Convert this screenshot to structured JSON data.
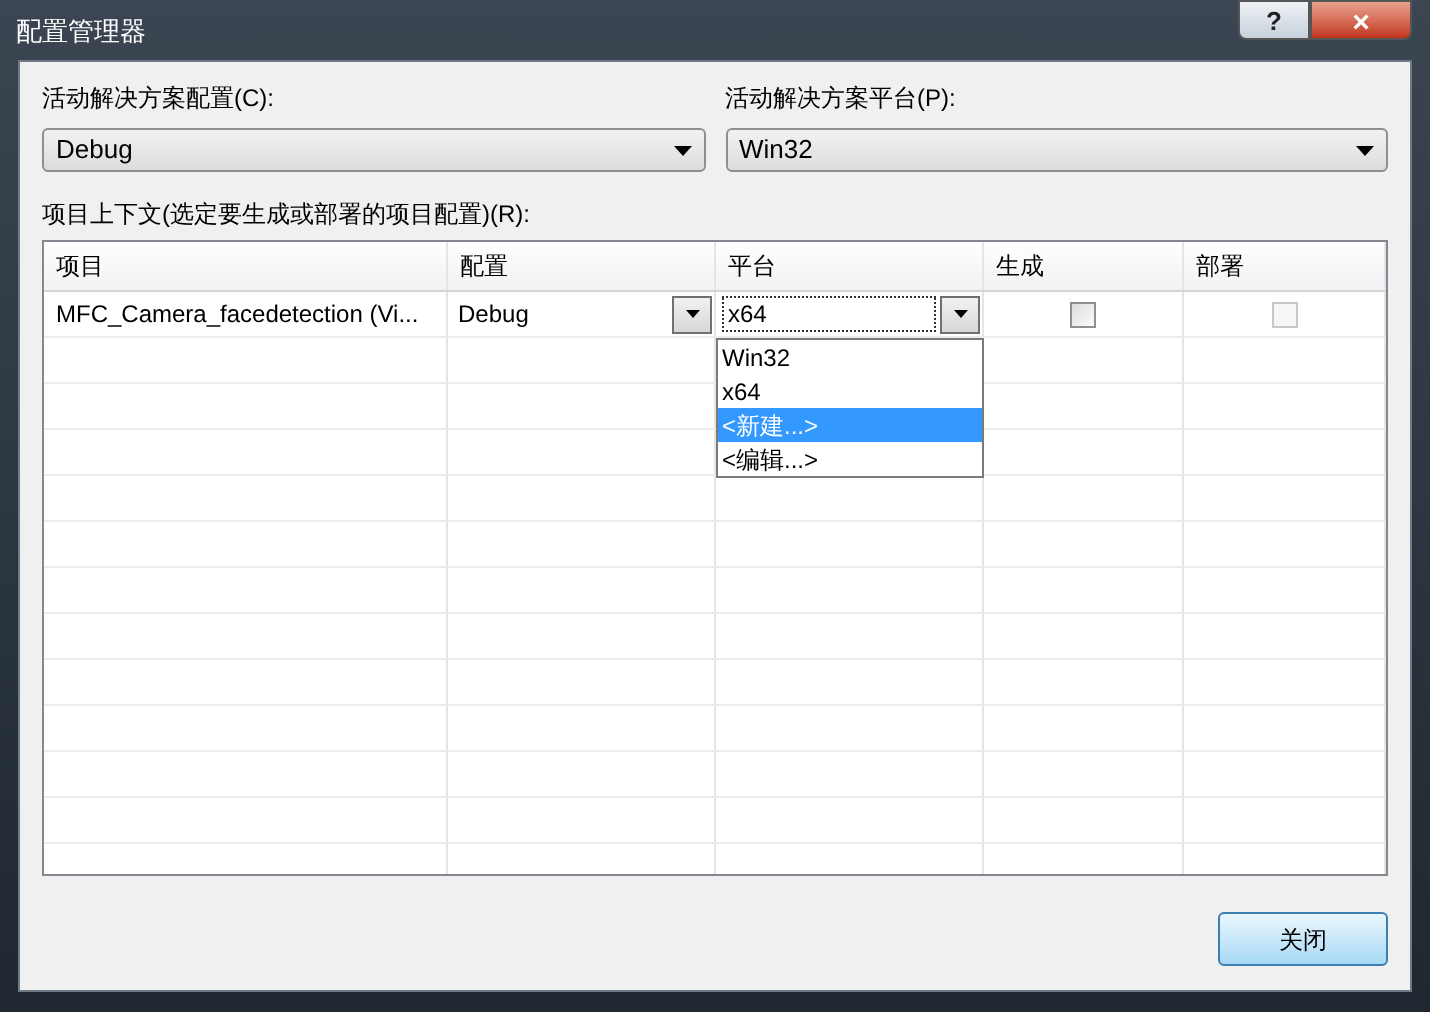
{
  "window": {
    "title": "配置管理器",
    "buttons": [
      "?",
      "×"
    ]
  },
  "solution_config": {
    "label": "活动解决方案配置(C):",
    "value": "Debug"
  },
  "solution_platform": {
    "label": "活动解决方案平台(P):",
    "value": "Win32"
  },
  "project_contexts": {
    "label": "项目上下文(选定要生成或部署的项目配置)(R):",
    "columns": [
      "项目",
      "配置",
      "平台",
      "生成",
      "部署"
    ],
    "rows": [
      {
        "project": "MFC_Camera_facedetection (Vi...",
        "configuration": "Debug",
        "platform": "x64",
        "build": {
          "checked": false,
          "disabled": false
        },
        "deploy": {
          "checked": false,
          "disabled": true
        }
      }
    ],
    "platform_dropdown": [
      {
        "label": "Win32",
        "selected": false
      },
      {
        "label": "x64",
        "selected": false
      },
      {
        "label": "<新建...>",
        "selected": true
      },
      {
        "label": "<编辑...>",
        "selected": false
      }
    ]
  },
  "buttons": [
    "关闭"
  ]
}
